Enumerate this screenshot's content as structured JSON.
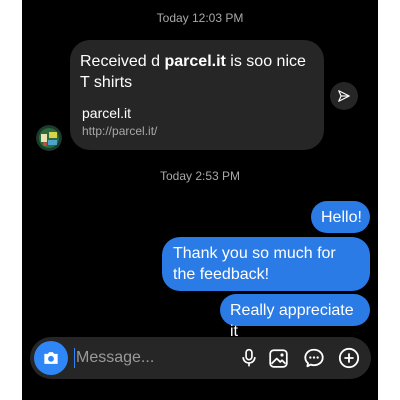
{
  "timestamps": {
    "first": "Today 12:03 PM",
    "second": "Today 2:53 PM"
  },
  "received_message": {
    "text_before": "Received d ",
    "text_bold": "parcel.it",
    "text_after": " is soo nice T shirts",
    "link_preview": {
      "title": "parcel.it",
      "url": "http://parcel.it/"
    }
  },
  "sent_messages": [
    "Hello!",
    "Thank you so much for the feedback!",
    "Really appreciate it"
  ],
  "composer": {
    "placeholder": "Message..."
  },
  "icons": {
    "avatar": "avatar",
    "share": "send-icon",
    "camera": "camera-icon",
    "mic": "microphone-icon",
    "gallery": "image-icon",
    "sticker": "sticker-chat-icon",
    "plus": "plus-circle-icon"
  },
  "colors": {
    "background": "#000000",
    "received_bubble": "#262626",
    "sent_bubble": "#2a7be6",
    "camera_button": "#2f86f6",
    "timestamp": "#a8a8a8"
  }
}
